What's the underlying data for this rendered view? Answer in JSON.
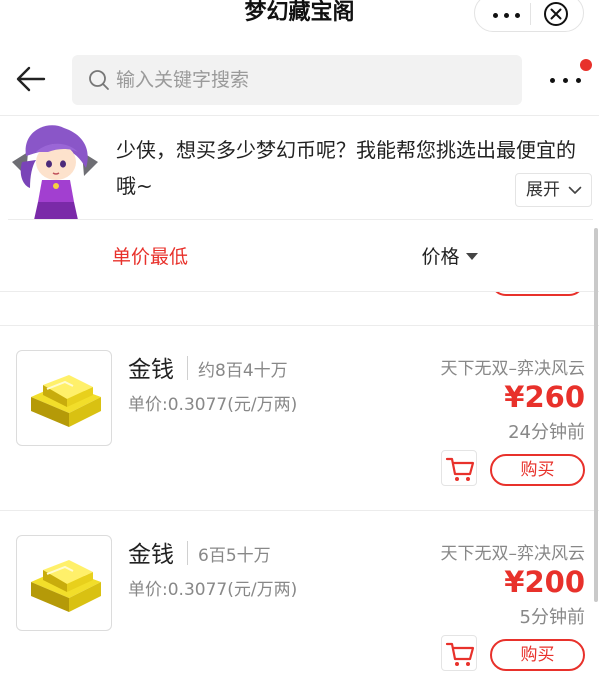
{
  "app": {
    "title": "梦幻藏宝阁"
  },
  "search": {
    "placeholder": "输入关键字搜索",
    "value": ""
  },
  "assistant": {
    "message": "少侠，想买多少梦幻币呢？我能帮您挑选出最便宜的哦~",
    "expand_label": "展开"
  },
  "sort": {
    "tabs": [
      {
        "label": "单价最低",
        "active": true
      },
      {
        "label": "价格",
        "active": false
      }
    ]
  },
  "listings": [
    {
      "name": "金钱",
      "quantity": "约8百4十万",
      "unit_price": "单价:0.3077(元/万两)",
      "server": "天下无双–弈决风云",
      "price": "¥260",
      "posted": "24分钟前",
      "buy_label": "购买"
    },
    {
      "name": "金钱",
      "quantity": "6百5十万",
      "unit_price": "单价:0.3077(元/万两)",
      "server": "天下无双–弈决风云",
      "price": "¥200",
      "posted": "5分钟前",
      "buy_label": "购买"
    }
  ],
  "colors": {
    "accent": "#e8312b",
    "muted_text": "#888888",
    "divider": "#ececec",
    "search_bg": "#f2f2f2"
  },
  "icons": {
    "capsule_more": "more-horizontal-icon",
    "capsule_close": "close-circle-icon",
    "back": "arrow-left-icon",
    "search": "search-icon",
    "menu": "more-horizontal-icon",
    "expand": "chevron-down-icon",
    "sort": "caret-down-icon",
    "cart": "cart-icon",
    "item_image": "gold-bars-icon",
    "avatar": "assistant-girl-avatar"
  }
}
